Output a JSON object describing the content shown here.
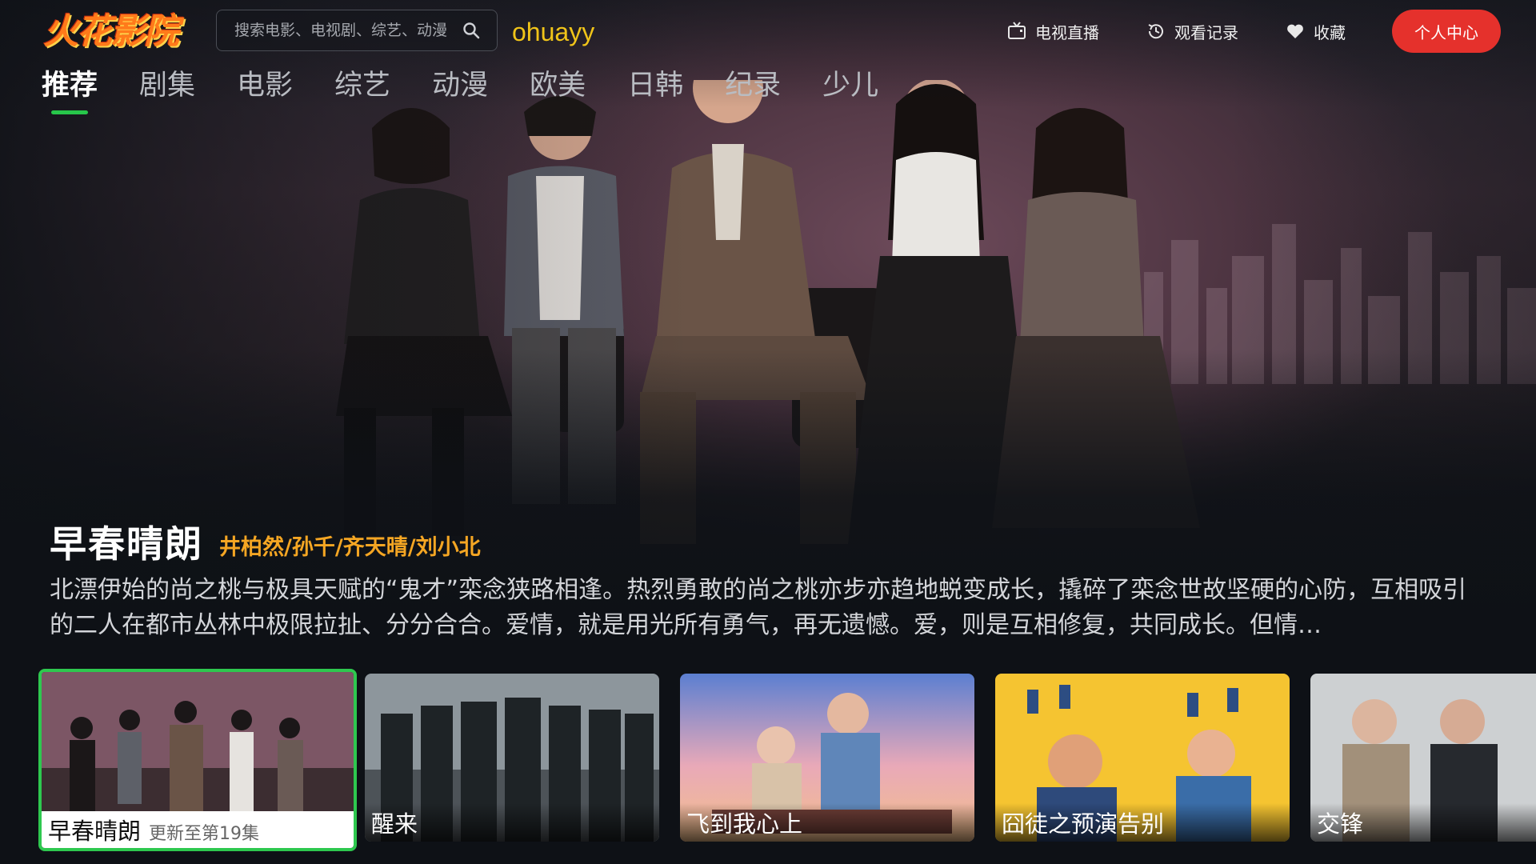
{
  "app": {
    "logo_text": "火花影院",
    "username": "ohuayy"
  },
  "search": {
    "placeholder": "搜索电影、电视剧、综艺、动漫"
  },
  "top_actions": {
    "live_tv": "电视直播",
    "history": "观看记录",
    "favorites": "收藏",
    "profile": "个人中心"
  },
  "tabs": [
    {
      "label": "推荐",
      "active": true
    },
    {
      "label": "剧集"
    },
    {
      "label": "电影"
    },
    {
      "label": "综艺"
    },
    {
      "label": "动漫"
    },
    {
      "label": "欧美"
    },
    {
      "label": "日韩"
    },
    {
      "label": "纪录"
    },
    {
      "label": "少儿"
    }
  ],
  "featured": {
    "title": "早春晴朗",
    "cast": "井柏然/孙千/齐天晴/刘小北",
    "synopsis": "北漂伊始的尚之桃与极具天赋的“鬼才”栾念狭路相逢。热烈勇敢的尚之桃亦步亦趋地蜕变成长，撬碎了栾念世故坚硬的心防，互相吸引的二人在都市丛林中极限拉扯、分分合合。爱情，就是用光所有勇气，再无遗憾。爱，则是互相修复，共同成长。但情…"
  },
  "cards": [
    {
      "title": "早春晴朗",
      "episode": "更新至第19集",
      "selected": true
    },
    {
      "title": "醒来"
    },
    {
      "title": "飞到我心上"
    },
    {
      "title": "囧徒之预演告别"
    },
    {
      "title": "交锋"
    }
  ],
  "colors": {
    "accent_green": "#2ec84f",
    "profile_red": "#e5312c",
    "cast_orange": "#f5a623",
    "username_yellow": "#f0c419"
  },
  "icons": [
    "search-icon",
    "tv-icon",
    "history-icon",
    "heart-icon"
  ]
}
